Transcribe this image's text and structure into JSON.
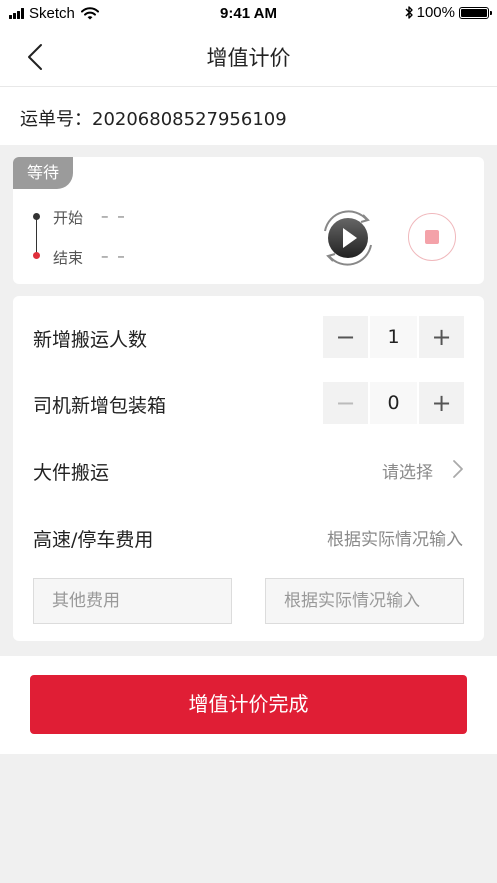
{
  "status_bar": {
    "carrier": "Sketch",
    "time": "9:41 AM",
    "battery": "100%"
  },
  "nav": {
    "title": "增值计价"
  },
  "order": {
    "text": "运单号：20206808527956109"
  },
  "timer": {
    "status_tag": "等待",
    "start_label": "开始",
    "start_value": "– –",
    "end_label": "结束",
    "end_value": "– –"
  },
  "form": {
    "movers": {
      "label": "新增搬运人数",
      "value": "1",
      "minus": "−",
      "plus": "+"
    },
    "boxes": {
      "label": "司机新增包装箱",
      "value": "0",
      "minus": "−",
      "plus": "+"
    },
    "large_item": {
      "label": "大件搬运",
      "placeholder": "请选择"
    },
    "highway_fee": {
      "label": "高速/停车费用",
      "placeholder": "根据实际情况输入"
    },
    "other_fee": {
      "name_placeholder": "其他费用",
      "amount_placeholder": "根据实际情况输入"
    }
  },
  "submit": {
    "label": "增值计价完成"
  },
  "colors": {
    "primary": "#e01e35",
    "tag_gray": "#9b9b9b",
    "end_dot": "#e0303c"
  }
}
